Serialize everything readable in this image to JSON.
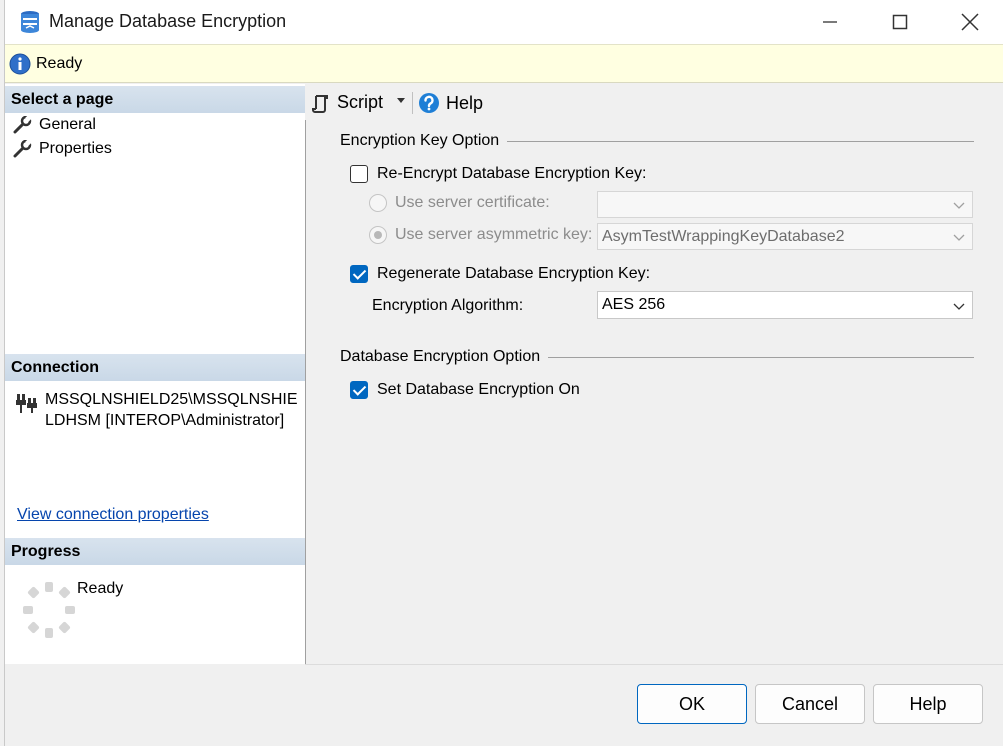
{
  "window": {
    "title": "Manage Database Encryption"
  },
  "infobar": {
    "status": "Ready"
  },
  "left": {
    "select_page_header": "Select a page",
    "pages": [
      {
        "label": "General"
      },
      {
        "label": "Properties"
      }
    ],
    "connection_header": "Connection",
    "connection_text": "MSSQLNSHIELD25\\MSSQLNSHIELDHSM [INTEROP\\Administrator]",
    "connection_link": "View connection properties",
    "progress_header": "Progress",
    "progress_status": "Ready"
  },
  "toolbar": {
    "script_label": "Script",
    "help_label": "Help"
  },
  "encryption_key": {
    "group_title": "Encryption Key Option",
    "reencrypt_label": "Re-Encrypt Database Encryption Key:",
    "reencrypt_checked": false,
    "server_cert_label": "Use server certificate:",
    "server_cert_value": "",
    "server_asym_label": "Use server asymmetric key:",
    "server_asym_value": "AsymTestWrappingKeyDatabase2",
    "regenerate_label": "Regenerate Database Encryption Key:",
    "regenerate_checked": true,
    "algorithm_label": "Encryption Algorithm:",
    "algorithm_value": "AES 256"
  },
  "db_encryption": {
    "group_title": "Database Encryption Option",
    "set_on_label": "Set Database Encryption On",
    "set_on_checked": true
  },
  "footer": {
    "ok_label": "OK",
    "cancel_label": "Cancel",
    "help_label": "Help"
  },
  "colors": {
    "accent": "#0067c0",
    "infobar_bg": "#ffffe1",
    "link": "#0645ad"
  }
}
